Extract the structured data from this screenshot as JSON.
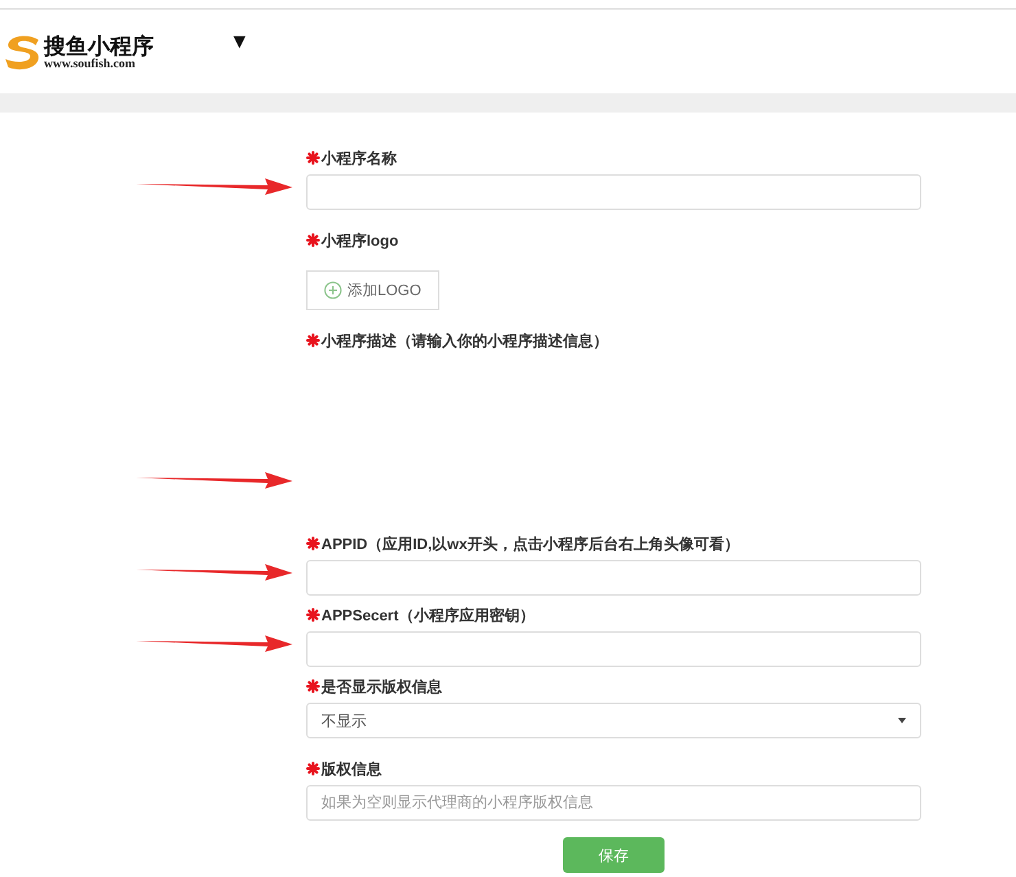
{
  "header": {
    "brand": "搜鱼小程序",
    "url": "www.soufish.com",
    "menu": "▼"
  },
  "fields": [
    {
      "kind": "text",
      "label": "小程序名称",
      "required": true,
      "arrow": true
    },
    {
      "kind": "upload",
      "label": "小程序logo",
      "required": true,
      "button": "添加LOGO",
      "arrow": false
    },
    {
      "kind": "blank",
      "label": "小程序描述（请输入你的小程序描述信息）",
      "required": true,
      "arrow": true
    },
    {
      "kind": "text",
      "label": "APPID（应用ID,以wx开头，点击小程序后台右上角头像可看）",
      "required": true,
      "arrow": true
    },
    {
      "kind": "text",
      "label": "APPSecert（小程序应用密钥）",
      "required": true,
      "arrow": true
    },
    {
      "kind": "select",
      "label": "是否显示版权信息",
      "required": true,
      "value": "不显示",
      "arrow": false
    },
    {
      "kind": "text",
      "label": "版权信息",
      "required": true,
      "placeholder": "如果为空则显示代理商的小程序版权信息",
      "arrow": false
    }
  ],
  "save_button": "保存"
}
